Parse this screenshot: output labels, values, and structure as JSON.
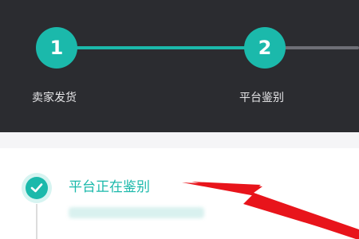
{
  "steps": [
    {
      "number": "1",
      "label": "卖家发货",
      "state": "done"
    },
    {
      "number": "2",
      "label": "平台鉴别",
      "state": "current"
    }
  ],
  "status": {
    "title": "平台正在鉴别",
    "icon": "check-icon"
  },
  "colors": {
    "header_bg": "#2b2c30",
    "accent": "#1bb9ab",
    "pending_line": "#6e6f76",
    "annotation": "#e8141b"
  }
}
